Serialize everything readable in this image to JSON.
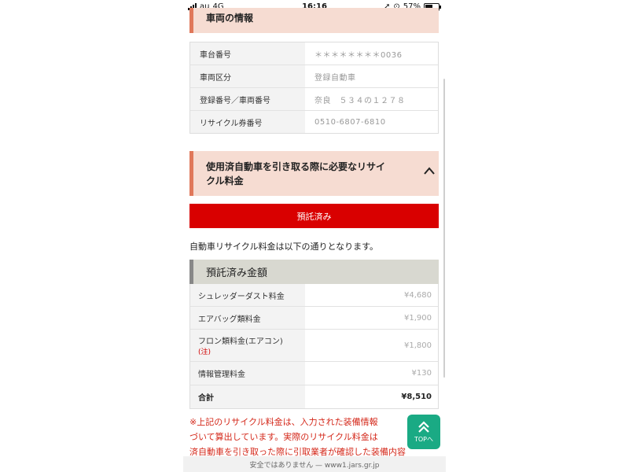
{
  "status_bar": {
    "carrier": "au",
    "network": "4G",
    "time": "16:16",
    "battery": "57%"
  },
  "vehicle_section": {
    "title": "車両の情報",
    "rows": [
      {
        "label": "車台番号",
        "value": "＊＊＊＊＊＊＊＊0036"
      },
      {
        "label": "車両区分",
        "value": "登録自動車"
      },
      {
        "label": "登録番号／車両番号",
        "value": "奈良　５３４の１２７８"
      },
      {
        "label": "リサイクル券番号",
        "value": "0510-6807-6810"
      }
    ]
  },
  "recycle_section": {
    "title_line1": "使用済自動車を引き取る際に必要なリサイ",
    "title_line2": "クル料金",
    "toggle_icon": "chevron-up-icon"
  },
  "status_button": "預託済み",
  "intro_text": "自動車リサイクル料金は以下の通りとなります。",
  "fee_section": {
    "title": "預託済み金額",
    "rows": [
      {
        "label": "シュレッダーダスト料金",
        "note": "",
        "value": "¥4,680"
      },
      {
        "label": "エアバッグ類料金",
        "note": "",
        "value": "¥1,900"
      },
      {
        "label": "フロン類料金(エアコン)",
        "note": "(注)",
        "value": "¥1,800"
      },
      {
        "label": "情報管理料金",
        "note": "",
        "value": "¥130"
      }
    ],
    "total_label": "合計",
    "total_value": "¥8,510"
  },
  "warning_lines": [
    "※上記のリサイクル料金は、入力された装備情報",
    "づいて算出しています。実際のリサイクル料金は",
    "済自動車を引き取った際に引取業者が確認した装備内容"
  ],
  "top_button": {
    "label": "TOPへ"
  },
  "url_bar": "安全ではありません — www1.jars.gr.jp",
  "colors": {
    "accent_red": "#d90000",
    "section_pink": "#f6dcd2",
    "top_green": "#1aaa84"
  }
}
